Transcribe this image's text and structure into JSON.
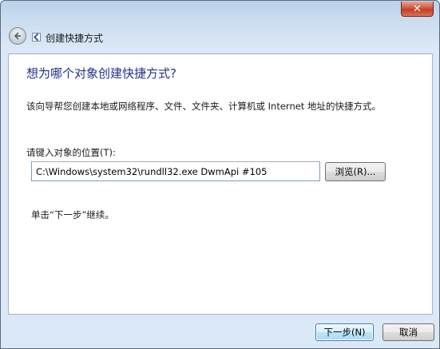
{
  "window": {
    "title": "创建快捷方式",
    "close_label": "✕"
  },
  "content": {
    "heading": "想为哪个对象创建快捷方式?",
    "description": "该向导帮您创建本地或网络程序、文件、文件夹、计算机或 Internet 地址的快捷方式。",
    "location_label": "请键入对象的位置(T):",
    "location_value": "C:\\Windows\\system32\\rundll32.exe DwmApi #105",
    "browse_label": "浏览(R)...",
    "hint": "单击“下一步”继续。"
  },
  "footer": {
    "next_label": "下一步(N)",
    "cancel_label": "取消"
  }
}
